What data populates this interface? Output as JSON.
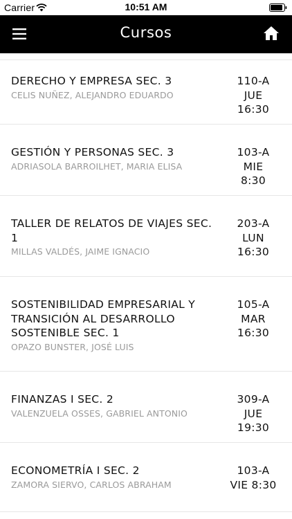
{
  "status_bar": {
    "carrier": "Carrier",
    "time": "10:51 AM"
  },
  "navbar": {
    "title": "Cursos"
  },
  "colors": {
    "navbar_bg": "#000000",
    "navbar_fg": "#ffffff",
    "teacher_text": "#9a9a9a"
  },
  "icons": {
    "menu": "hamburger-menu-icon",
    "home": "home-icon",
    "wifi": "wifi-icon",
    "battery": "battery-icon"
  },
  "courses": [
    {
      "name": "DERECHO Y EMPRESA SEC. 3",
      "teacher": "CELIS NUÑEZ, ALEJANDRO EDUARDO",
      "room": "110-A",
      "day": "JUE",
      "time": "16:30"
    },
    {
      "name": "GESTIÓN Y PERSONAS SEC. 3",
      "teacher": "ADRIASOLA BARROILHET, MARIA ELISA",
      "room": "103-A",
      "day": "MIE",
      "time": "8:30"
    },
    {
      "name": "TALLER DE RELATOS DE VIAJES SEC. 1",
      "teacher": "MILLAS VALDÉS, JAIME IGNACIO",
      "room": "203-A",
      "day": "LUN",
      "time": "16:30"
    },
    {
      "name": "SOSTENIBILIDAD EMPRESARIAL Y TRANSICIÓN AL DESARROLLO SOSTENIBLE SEC. 1",
      "teacher": "OPAZO BUNSTER, JOSÉ LUIS",
      "room": "105-A",
      "day": "MAR",
      "time": "16:30"
    },
    {
      "name": "FINANZAS I SEC. 2",
      "teacher": "VALENZUELA OSSES, GABRIEL ANTONIO",
      "room": "309-A",
      "day": "JUE",
      "time": "19:30"
    },
    {
      "name": "ECONOMETRÍA I SEC. 2",
      "teacher": "ZAMORA SIERVO, CARLOS ABRAHAM",
      "room": "103-A",
      "day": "VIE 8:30",
      "time": ""
    }
  ]
}
